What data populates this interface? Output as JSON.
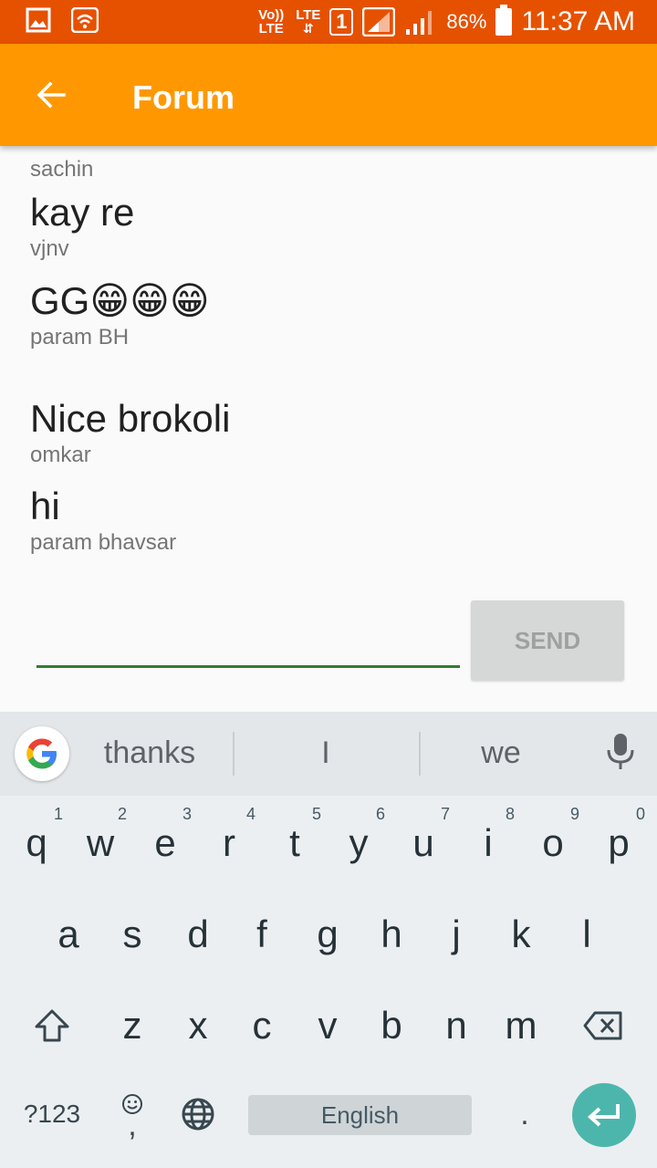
{
  "status_bar": {
    "volte": "Vo)) LTE",
    "lte": "LTE",
    "sim": "1",
    "battery_pct": "86%",
    "time": "11:37 AM",
    "bg_color": "#e65100"
  },
  "app_bar": {
    "title": "Forum",
    "back_icon": "arrow-back-icon",
    "bg_color": "#ff9800"
  },
  "messages": [
    {
      "text": "kay re",
      "author": "vjnv"
    },
    {
      "text": "GG😁😁😁",
      "author": "param BH"
    },
    {
      "text": "Nice brokoli",
      "author": "omkar"
    },
    {
      "text": "hi",
      "author": "param bhavsar"
    }
  ],
  "cut_author": "sachin",
  "composer": {
    "input_value": "",
    "send_label": "SEND",
    "underline_color": "#2e7d32"
  },
  "keyboard": {
    "suggestions": [
      "thanks",
      "I",
      "we"
    ],
    "row1": [
      {
        "k": "q",
        "n": "1"
      },
      {
        "k": "w",
        "n": "2"
      },
      {
        "k": "e",
        "n": "3"
      },
      {
        "k": "r",
        "n": "4"
      },
      {
        "k": "t",
        "n": "5"
      },
      {
        "k": "y",
        "n": "6"
      },
      {
        "k": "u",
        "n": "7"
      },
      {
        "k": "i",
        "n": "8"
      },
      {
        "k": "o",
        "n": "9"
      },
      {
        "k": "p",
        "n": "0"
      }
    ],
    "row2": [
      "a",
      "s",
      "d",
      "f",
      "g",
      "h",
      "j",
      "k",
      "l"
    ],
    "row3": [
      "z",
      "x",
      "c",
      "v",
      "b",
      "n",
      "m"
    ],
    "symbols_label": "?123",
    "comma_label": ",",
    "period_label": ".",
    "space_label": "English",
    "enter_color": "#4db6ac"
  }
}
